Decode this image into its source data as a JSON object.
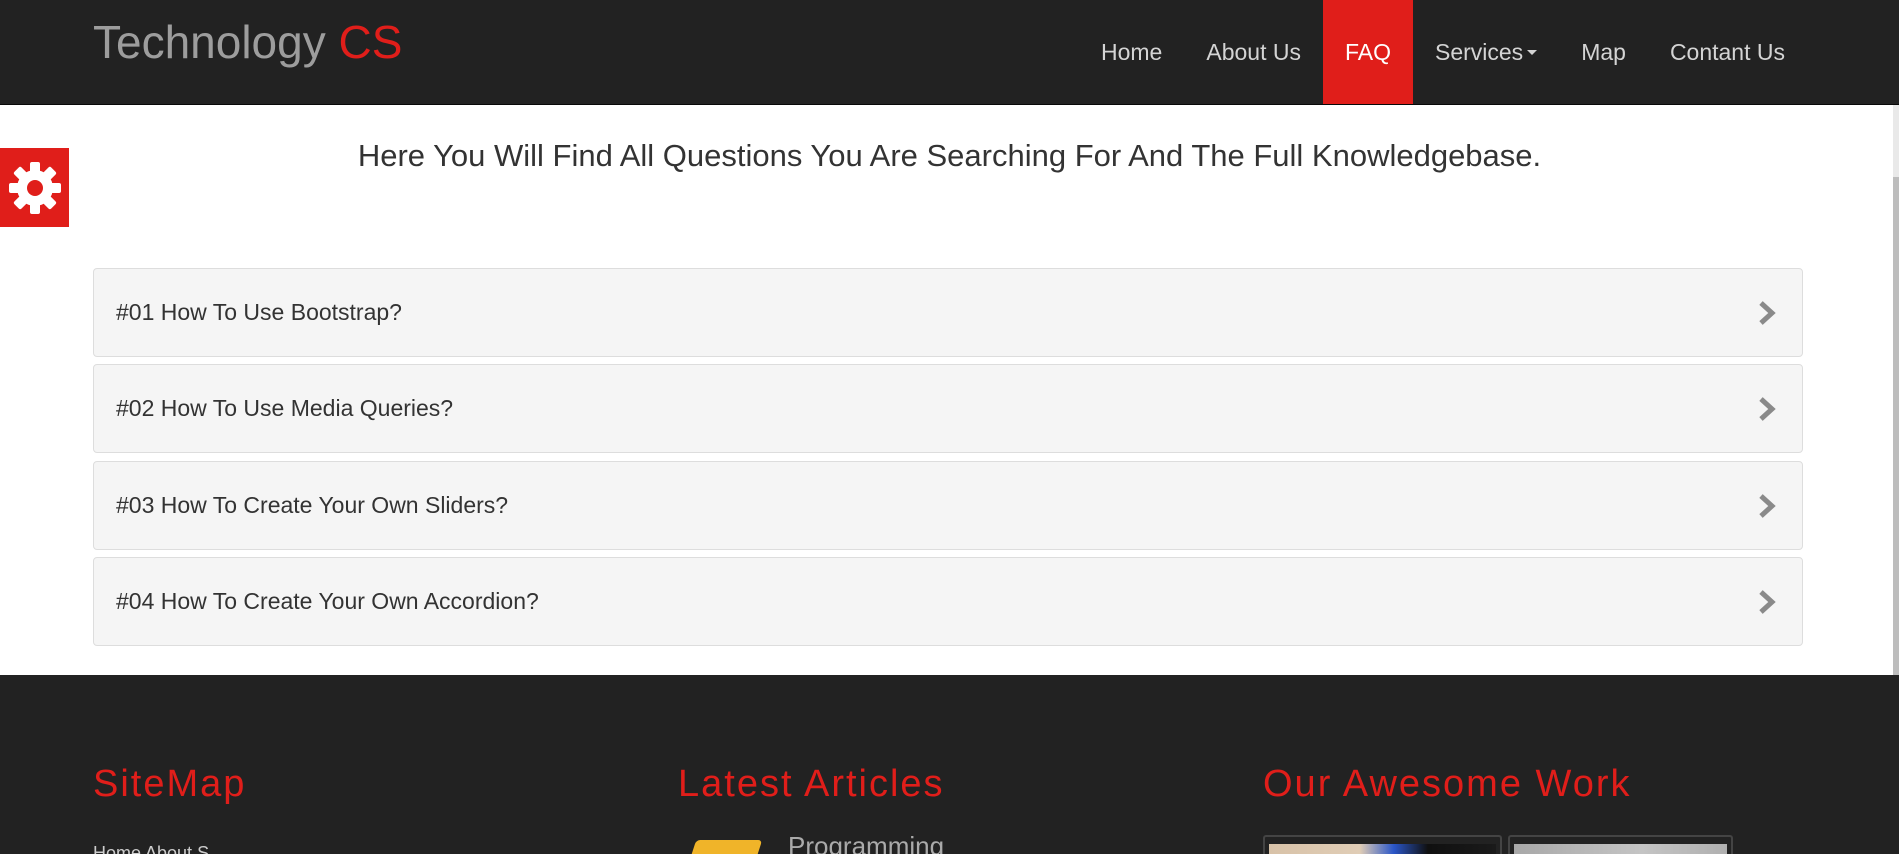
{
  "brand": {
    "text": "Technology",
    "accent": "CS"
  },
  "nav": {
    "items": [
      {
        "label": "Home",
        "active": false
      },
      {
        "label": "About Us",
        "active": false
      },
      {
        "label": "FAQ",
        "active": true
      },
      {
        "label": "Services",
        "active": false,
        "dropdown": true
      },
      {
        "label": "Map",
        "active": false
      },
      {
        "label": "Contant Us",
        "active": false
      }
    ]
  },
  "settings": {
    "icon": "gear-icon"
  },
  "faq": {
    "lead": "Here You Will Find All Questions You Are Searching For And The Full Knowledgebase.",
    "items": [
      {
        "question": "#01 How To Use Bootstrap?"
      },
      {
        "question": "#02 How To Use Media Queries?"
      },
      {
        "question": "#03 How To Create Your Own Sliders?"
      },
      {
        "question": "#04 How To Create Your Own Accordion?"
      }
    ]
  },
  "footer": {
    "sitemap_title": "SiteMap",
    "sitemap_links": "Home                    About                    S",
    "articles_title": "Latest Articles",
    "article_1_title": "Programming",
    "work_title": "Our Awesome Work"
  },
  "colors": {
    "accent": "#e01e1a",
    "navbar": "#222222",
    "panel": "#f5f5f5"
  }
}
